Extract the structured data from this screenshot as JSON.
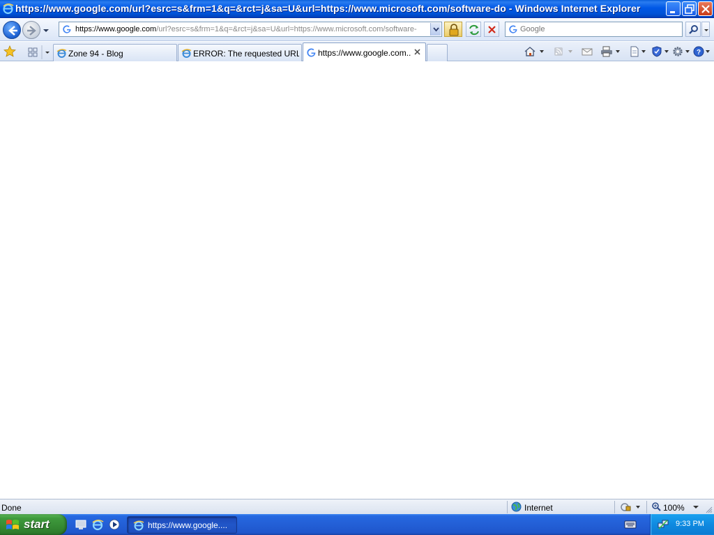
{
  "window": {
    "title": "https://www.google.com/url?esrc=s&frm=1&q=&rct=j&sa=U&url=https://www.microsoft.com/software-do - Windows Internet Explorer",
    "icon": "ie-icon"
  },
  "address_bar": {
    "url_prefix": "https://",
    "url_host": "www.google.com",
    "url_rest": "/url?esrc=s&frm=1&q=&rct=j&sa=U&url=https://www.microsoft.com/software-"
  },
  "search": {
    "placeholder": "Google"
  },
  "tabs": [
    {
      "label": "Zone 94 - Blog",
      "icon": "ie-page-icon",
      "active": false
    },
    {
      "label": "ERROR: The requested URL ...",
      "icon": "ie-page-icon",
      "active": false
    },
    {
      "label": "https://www.google.com...",
      "icon": "google-icon",
      "active": true
    }
  ],
  "status_bar": {
    "text": "Done",
    "zone": "Internet",
    "zoom": "100%"
  },
  "taskbar": {
    "start_label": "start",
    "active_window": "https://www.google....",
    "clock": "9:33 PM"
  },
  "colors": {
    "titlebar": "#0058e6",
    "taskbar": "#235fd6",
    "start_button": "#3f9a3d",
    "tray": "#0f8ae0"
  }
}
